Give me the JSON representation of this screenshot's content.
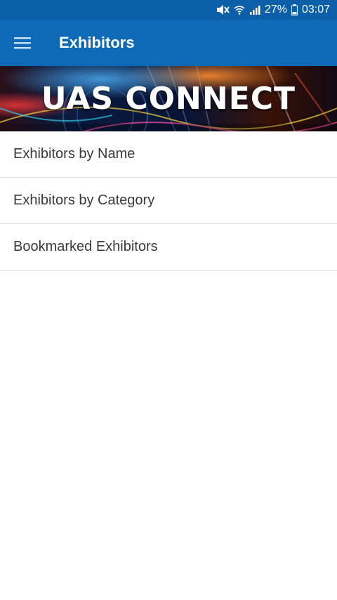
{
  "status_bar": {
    "battery_percent": "27%",
    "time": "03:07",
    "icons": [
      "mute-icon",
      "wifi-icon",
      "signal-icon",
      "battery-icon"
    ]
  },
  "app_bar": {
    "title": "Exhibitors",
    "menu_icon": "hamburger-menu-icon"
  },
  "banner": {
    "text": "UAS CONNECT"
  },
  "list": {
    "items": [
      {
        "label": "Exhibitors by Name"
      },
      {
        "label": "Exhibitors by Category"
      },
      {
        "label": "Bookmarked Exhibitors"
      }
    ]
  },
  "colors": {
    "status_bar": "#0b5ea8",
    "app_bar": "#0e6ab6",
    "list_text": "#3a3a3a",
    "divider": "#dcdcdc"
  }
}
